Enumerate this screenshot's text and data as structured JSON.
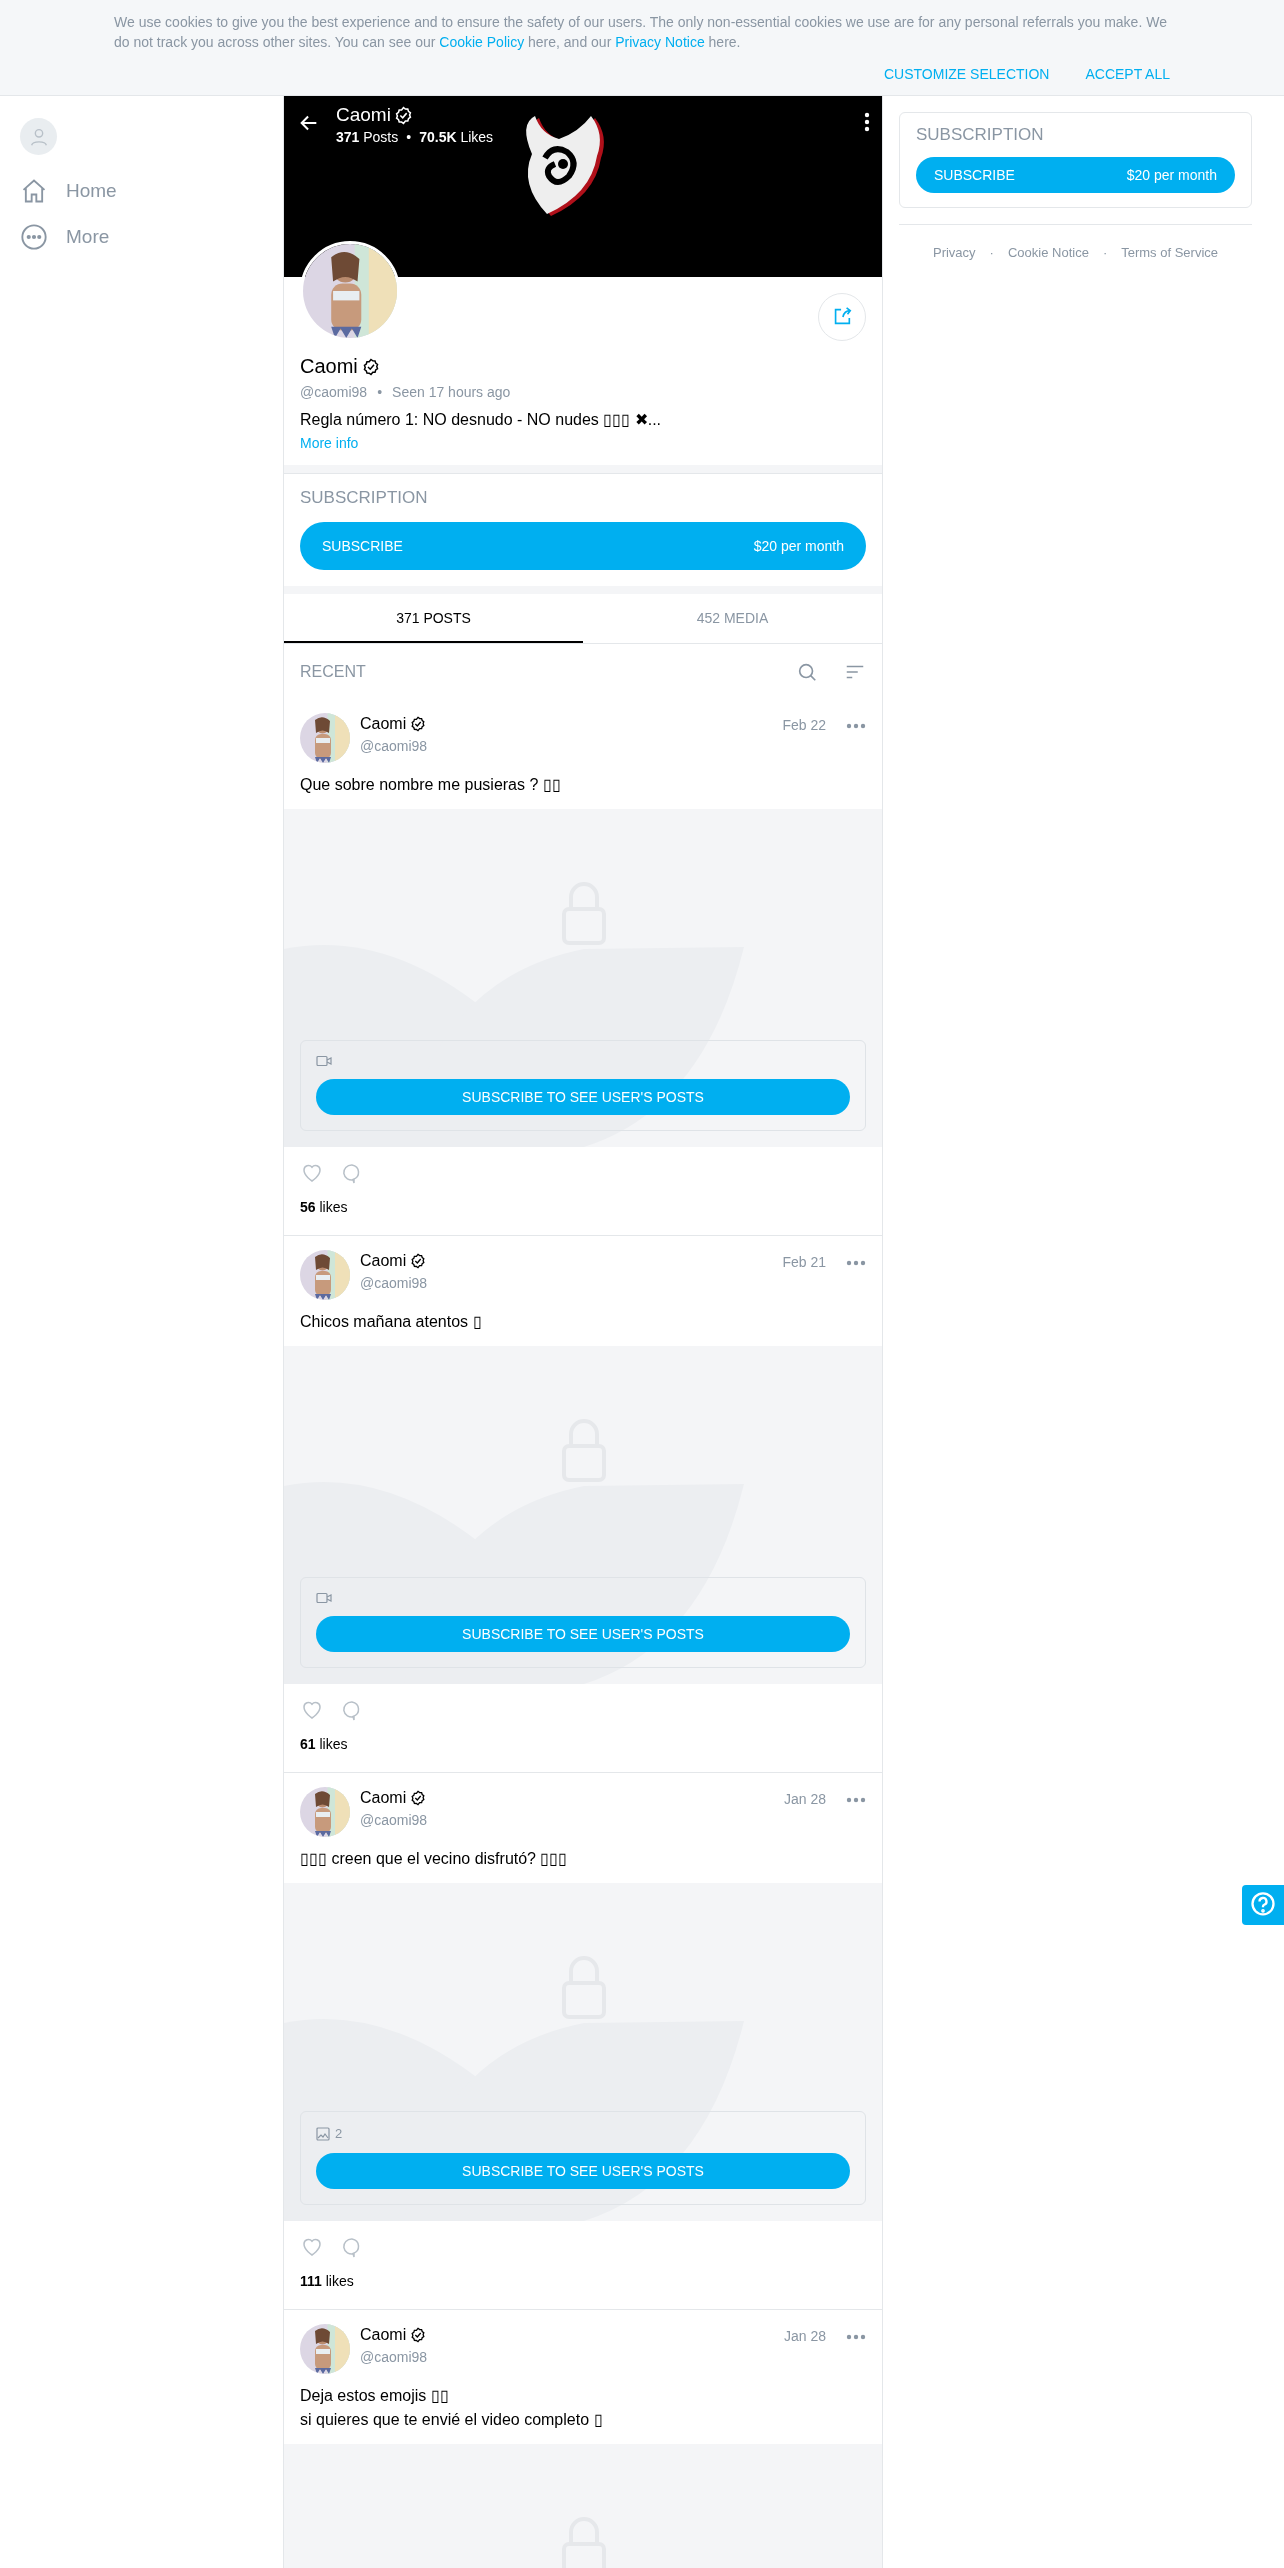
{
  "cookie_banner": {
    "message": [
      {
        "kind": "text",
        "text": "We use cookies to give you the best experience and to ensure the safety of our users. The only non-essential cookies we use are for any personal referrals you make. We do not track you across other sites. You can see our "
      },
      {
        "kind": "link",
        "text": "Cookie Policy"
      },
      {
        "kind": "text",
        "text": " here, and our "
      },
      {
        "kind": "link",
        "text": "Privacy Notice"
      },
      {
        "kind": "text",
        "text": " here."
      }
    ],
    "actions": [
      "CUSTOMIZE SELECTION",
      "ACCEPT ALL"
    ]
  },
  "sidebar": {
    "items": [
      {
        "label": "Home"
      },
      {
        "label": "More"
      }
    ]
  },
  "profile": {
    "header_name": "Caomi",
    "header_verified": true,
    "stats": [
      "**371** Posts",
      "**70.5K** Likes"
    ],
    "stats_separator": "•",
    "meta_separator": "•",
    "name": "Caomi",
    "verified": true,
    "handle": "@caomi98",
    "seen": "Seen 17 hours ago",
    "bio": "Regla número 1: NO desnudo - NO nudes ▯▯▯ ✖...",
    "more_info": "More info"
  },
  "subscription": {
    "title": "SUBSCRIPTION",
    "button": "SUBSCRIBE",
    "price": "$20 per month"
  },
  "tabs": [
    {
      "label": "371 POSTS",
      "selected": true
    },
    {
      "label": "452 MEDIA",
      "selected": false
    }
  ],
  "feed_label": "RECENT",
  "posts": [
    {
      "name": "Caomi",
      "verified": true,
      "handle": "@caomi98",
      "date": "Feb 22",
      "text": [
        "Que sobre nombre me pusieras ? ▯▯"
      ],
      "media": {
        "kind": "video"
      },
      "button": "SUBSCRIBE TO SEE USER'S POSTS",
      "likes": "**56** likes"
    },
    {
      "name": "Caomi",
      "verified": true,
      "handle": "@caomi98",
      "date": "Feb 21",
      "text": [
        "Chicos mañana atentos ▯"
      ],
      "media": {
        "kind": "video"
      },
      "button": "SUBSCRIBE TO SEE USER'S POSTS",
      "likes": "**61** likes"
    },
    {
      "name": "Caomi",
      "verified": true,
      "handle": "@caomi98",
      "date": "Jan 28",
      "text": [
        "▯▯▯ creen que el vecino disfrutó? ▯▯▯"
      ],
      "media": {
        "kind": "photos",
        "count": "2"
      },
      "button": "SUBSCRIBE TO SEE USER'S POSTS",
      "likes": "**111** likes"
    },
    {
      "name": "Caomi",
      "verified": true,
      "handle": "@caomi98",
      "date": "Jan 28",
      "text": [
        "Deja estos emojis ▯▯",
        "si quieres que te envié el video completo ▯"
      ]
    }
  ],
  "side_card": {
    "title": "SUBSCRIPTION",
    "button": "SUBSCRIBE",
    "price": "$20 per month"
  },
  "footer_links": [
    "Privacy",
    "Cookie Notice",
    "Terms of Service"
  ],
  "footer_separators": [
    "·",
    "·"
  ]
}
